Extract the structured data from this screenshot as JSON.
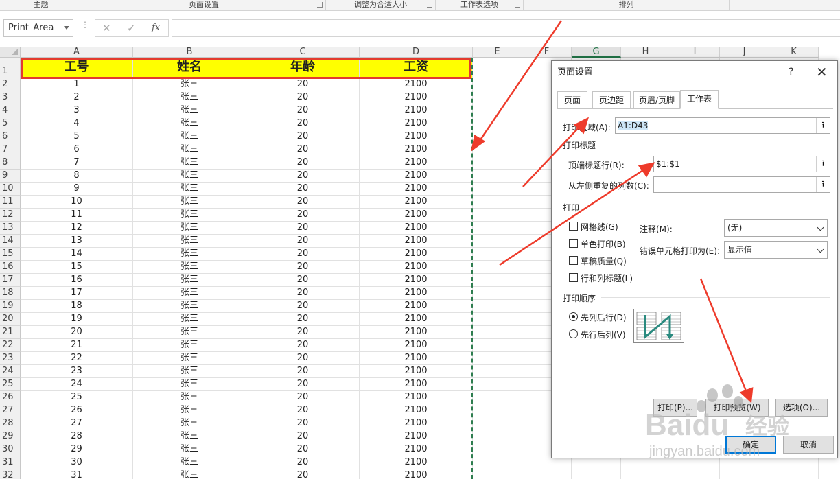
{
  "ribbon": {
    "groups": [
      "主题",
      "页面设置",
      "调整为合适大小",
      "工作表选项",
      "排列"
    ]
  },
  "formula_bar": {
    "name_box": "Print_Area",
    "cancel_icon": "✕",
    "enter_icon": "✓",
    "fx_label": "fx",
    "formula": ""
  },
  "columns": [
    "A",
    "B",
    "C",
    "D",
    "E",
    "F",
    "G",
    "H",
    "I",
    "J",
    "K"
  ],
  "selected_column": "G",
  "header_row": [
    "工号",
    "姓名",
    "年龄",
    "工资"
  ],
  "rows": [
    [
      "1",
      "张三",
      "20",
      "2100"
    ],
    [
      "2",
      "张三",
      "20",
      "2100"
    ],
    [
      "3",
      "张三",
      "20",
      "2100"
    ],
    [
      "4",
      "张三",
      "20",
      "2100"
    ],
    [
      "5",
      "张三",
      "20",
      "2100"
    ],
    [
      "6",
      "张三",
      "20",
      "2100"
    ],
    [
      "7",
      "张三",
      "20",
      "2100"
    ],
    [
      "8",
      "张三",
      "20",
      "2100"
    ],
    [
      "9",
      "张三",
      "20",
      "2100"
    ],
    [
      "10",
      "张三",
      "20",
      "2100"
    ],
    [
      "11",
      "张三",
      "20",
      "2100"
    ],
    [
      "12",
      "张三",
      "20",
      "2100"
    ],
    [
      "13",
      "张三",
      "20",
      "2100"
    ],
    [
      "14",
      "张三",
      "20",
      "2100"
    ],
    [
      "15",
      "张三",
      "20",
      "2100"
    ],
    [
      "16",
      "张三",
      "20",
      "2100"
    ],
    [
      "17",
      "张三",
      "20",
      "2100"
    ],
    [
      "18",
      "张三",
      "20",
      "2100"
    ],
    [
      "19",
      "张三",
      "20",
      "2100"
    ],
    [
      "20",
      "张三",
      "20",
      "2100"
    ],
    [
      "21",
      "张三",
      "20",
      "2100"
    ],
    [
      "22",
      "张三",
      "20",
      "2100"
    ],
    [
      "23",
      "张三",
      "20",
      "2100"
    ],
    [
      "24",
      "张三",
      "20",
      "2100"
    ],
    [
      "25",
      "张三",
      "20",
      "2100"
    ],
    [
      "26",
      "张三",
      "20",
      "2100"
    ],
    [
      "27",
      "张三",
      "20",
      "2100"
    ],
    [
      "28",
      "张三",
      "20",
      "2100"
    ],
    [
      "29",
      "张三",
      "20",
      "2100"
    ],
    [
      "30",
      "张三",
      "20",
      "2100"
    ],
    [
      "31",
      "张三",
      "20",
      "2100"
    ]
  ],
  "row_numbers": [
    "1",
    "2",
    "3",
    "4",
    "5",
    "6",
    "7",
    "8",
    "9",
    "10",
    "11",
    "12",
    "13",
    "14",
    "15",
    "16",
    "17",
    "18",
    "19",
    "20",
    "21",
    "22",
    "23",
    "24",
    "25",
    "26",
    "27",
    "28",
    "29",
    "30",
    "31",
    "32"
  ],
  "dialog": {
    "title": "页面设置",
    "help": "?",
    "close": "✕",
    "tabs": [
      "页面",
      "页边距",
      "页眉/页脚",
      "工作表"
    ],
    "active_tab": "工作表",
    "print_area_label": "打印区域(A):",
    "print_area_value": "A1:D43",
    "print_titles_label": "打印标题",
    "top_rows_label": "顶端标题行(R):",
    "top_rows_value": "$1:$1",
    "left_cols_label": "从左侧重复的列数(C):",
    "left_cols_value": "",
    "print_section_label": "打印",
    "gridlines_label": "网格线(G)",
    "bw_label": "单色打印(B)",
    "draft_label": "草稿质量(Q)",
    "rowcol_label": "行和列标题(L)",
    "comments_label": "注释(M):",
    "comments_value": "(无)",
    "errors_label": "错误单元格打印为(E):",
    "errors_value": "显示值",
    "order_label": "打印顺序",
    "down_then_over": "先列后行(D)",
    "over_then_down": "先行后列(V)",
    "print_btn": "打印(P)...",
    "preview_btn": "打印预览(W)",
    "options_btn": "选项(O)...",
    "ok_btn": "确定",
    "cancel_btn": "取消"
  },
  "watermark": {
    "brand": "Baidu",
    "cn": "经验",
    "url": "jingyan.baidu.com"
  },
  "colors": {
    "header_fill": "#ffff00",
    "highlight_border": "#e33b2e",
    "print_border": "#2e7d4f",
    "arrow": "#ee3b2b"
  }
}
